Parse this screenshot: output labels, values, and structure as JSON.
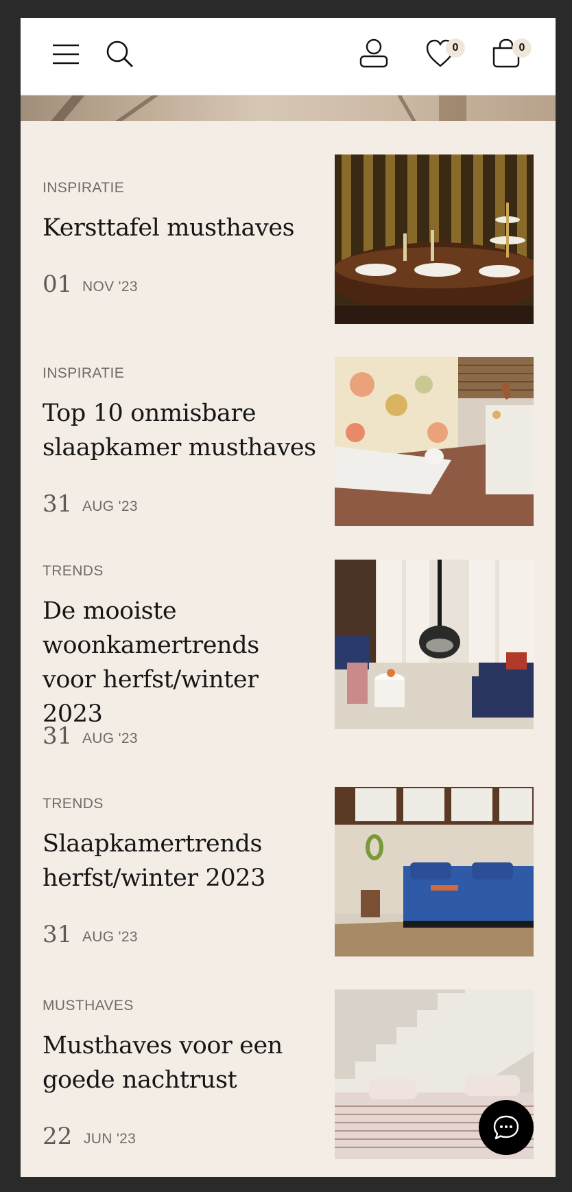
{
  "header": {
    "menu_icon": "menu-icon",
    "search_icon": "search-icon",
    "account_icon": "user-icon",
    "wishlist_icon": "heart-icon",
    "wishlist_count": "0",
    "cart_icon": "shopping-bag-icon",
    "cart_count": "0"
  },
  "articles": [
    {
      "category": "INSPIRATIE",
      "title": "Kersttafel musthaves",
      "day": "01",
      "month": "NOV '23"
    },
    {
      "category": "INSPIRATIE",
      "title": "Top 10 onmisbare slaapkamer musthaves",
      "day": "31",
      "month": "AUG '23"
    },
    {
      "category": "TRENDS",
      "title": "De mooiste woonkamertrends voor herfst/winter 2023",
      "day": "31",
      "month": "AUG '23"
    },
    {
      "category": "TRENDS",
      "title": "Slaapkamertrends herfst/winter 2023",
      "day": "31",
      "month": "AUG '23"
    },
    {
      "category": "MUSTHAVES",
      "title": "Musthaves voor een goede nachtrust",
      "day": "22",
      "month": "JUN '23"
    }
  ],
  "chat": {
    "icon": "chat-bubble-icon"
  },
  "colors": {
    "background": "#f4ede6",
    "text": "#161616",
    "muted": "#6f6a66",
    "badge": "#f1e6da"
  }
}
